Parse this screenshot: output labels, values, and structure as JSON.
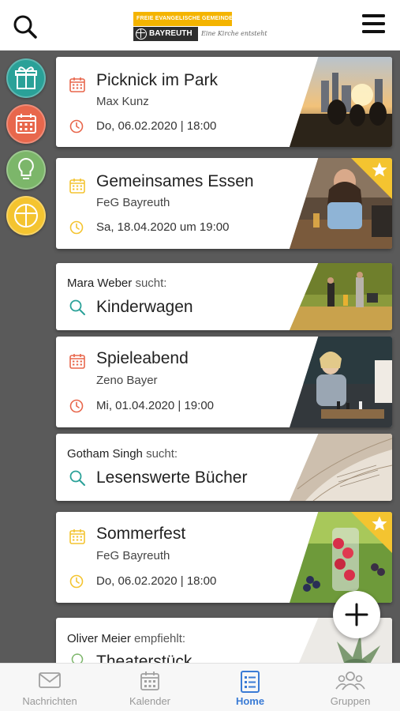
{
  "header": {
    "logo_top": "FREIE EVANGELISCHE GEMEINDE",
    "logo_city": "BAYREUTH",
    "logo_tagline": "Eine Kirche entsteht"
  },
  "side_categories": [
    {
      "icon": "gift-icon",
      "color": "#2aa198"
    },
    {
      "icon": "calendar-icon",
      "color": "#e8674c"
    },
    {
      "icon": "lightbulb-icon",
      "color": "#7cb66a"
    },
    {
      "icon": "cross-icon",
      "color": "#f4c430"
    }
  ],
  "feed": [
    {
      "type": "event",
      "title": "Picknick im Park",
      "organizer": "Max Kunz",
      "date": "Do, 06.02.2020 | 18:00",
      "accent": "#e8674c",
      "featured": false
    },
    {
      "type": "event",
      "title": "Gemeinsames Essen",
      "organizer": "FeG Bayreuth",
      "date": "Sa, 18.04.2020 um 19:00",
      "accent": "#f4c430",
      "featured": true
    },
    {
      "type": "request",
      "person": "Mara Weber",
      "verb": "sucht:",
      "item": "Kinderwagen",
      "accent": "#2aa198"
    },
    {
      "type": "event",
      "title": "Spieleabend",
      "organizer": "Zeno Bayer",
      "date": "Mi, 01.04.2020 | 19:00",
      "accent": "#e8674c",
      "featured": false
    },
    {
      "type": "request",
      "person": "Gotham Singh",
      "verb": "sucht:",
      "item": "Lesenswerte Bücher",
      "accent": "#2aa198"
    },
    {
      "type": "event",
      "title": "Sommerfest",
      "organizer": "FeG Bayreuth",
      "date": "Do, 06.02.2020 | 18:00",
      "accent": "#f4c430",
      "featured": true
    },
    {
      "type": "recommendation",
      "person": "Oliver Meier",
      "verb": "empfiehlt:",
      "item": "Theaterstück",
      "accent": "#7cb66a"
    }
  ],
  "bottom_nav": [
    {
      "label": "Nachrichten",
      "icon": "mail-icon",
      "active": false
    },
    {
      "label": "Kalender",
      "icon": "calendar-icon",
      "active": false
    },
    {
      "label": "Home",
      "icon": "home-list-icon",
      "active": true
    },
    {
      "label": "Gruppen",
      "icon": "groups-icon",
      "active": false
    }
  ]
}
